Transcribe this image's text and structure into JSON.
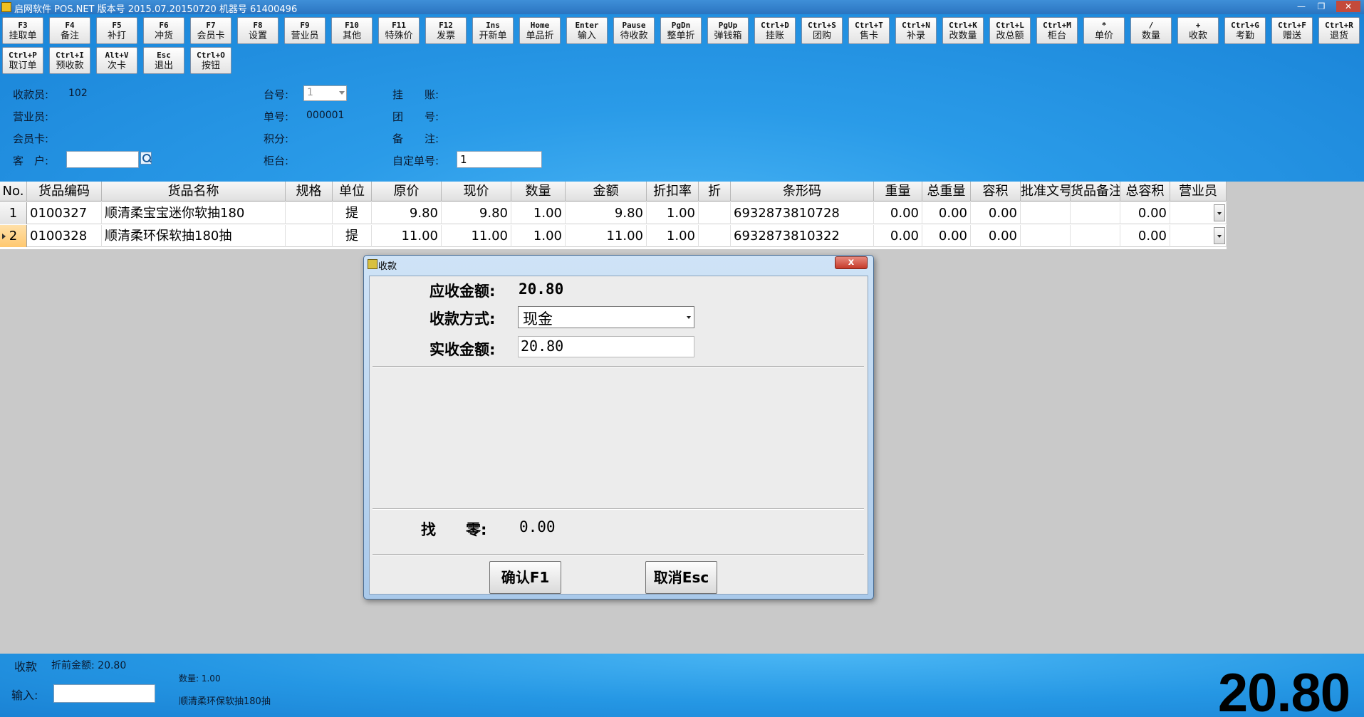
{
  "window": {
    "title": "启网软件 POS.NET 版本号 2015.07.20150720 机器号 61400496",
    "min_glyph": "—",
    "max_glyph": "❐",
    "close_glyph": "✕"
  },
  "toolbar": [
    {
      "key": "F3",
      "label": "挂取单"
    },
    {
      "key": "F4",
      "label": "备注"
    },
    {
      "key": "F5",
      "label": "补打"
    },
    {
      "key": "F6",
      "label": "冲货"
    },
    {
      "key": "F7",
      "label": "会员卡"
    },
    {
      "key": "F8",
      "label": "设置"
    },
    {
      "key": "F9",
      "label": "营业员"
    },
    {
      "key": "F10",
      "label": "其他"
    },
    {
      "key": "F11",
      "label": "特殊价"
    },
    {
      "key": "F12",
      "label": "发票"
    },
    {
      "key": "Ins",
      "label": "开新单"
    },
    {
      "key": "Home",
      "label": "单品折"
    },
    {
      "key": "Enter",
      "label": "输入"
    },
    {
      "key": "Pause",
      "label": "待收款"
    },
    {
      "key": "PgDn",
      "label": "整单折"
    },
    {
      "key": "PgUp",
      "label": "弹钱箱"
    },
    {
      "key": "Ctrl+D",
      "label": "挂账"
    },
    {
      "key": "Ctrl+S",
      "label": "团购"
    },
    {
      "key": "Ctrl+T",
      "label": "售卡"
    },
    {
      "key": "Ctrl+N",
      "label": "补录"
    },
    {
      "key": "Ctrl+K",
      "label": "改数量"
    },
    {
      "key": "Ctrl+L",
      "label": "改总额"
    },
    {
      "key": "Ctrl+M",
      "label": "柜台"
    },
    {
      "key": "*",
      "label": "单价"
    },
    {
      "key": "/",
      "label": "数量"
    },
    {
      "key": "+",
      "label": "收款"
    },
    {
      "key": "Ctrl+G",
      "label": "考勤"
    },
    {
      "key": "Ctrl+F",
      "label": "赠送"
    },
    {
      "key": "Ctrl+R",
      "label": "退货"
    },
    {
      "key": "Ctrl+P",
      "label": "取订单"
    },
    {
      "key": "Ctrl+I",
      "label": "预收款"
    },
    {
      "key": "Alt+V",
      "label": "次卡"
    },
    {
      "key": "Esc",
      "label": "退出"
    },
    {
      "key": "Ctrl+O",
      "label": "按钮"
    }
  ],
  "info": {
    "cashier_label": "收款员:",
    "cashier_value": "102",
    "salesperson_label": "营业员:",
    "member_label": "会员卡:",
    "customer_label": "客　户:",
    "customer_value": "",
    "table_label": "台号:",
    "table_value": "1",
    "order_no_label": "单号:",
    "order_no_value": "000001",
    "points_label": "积分:",
    "counter_label": "柜台:",
    "account_label": "挂　　账:",
    "group_label": "团　　号:",
    "remark_label": "备　　注:",
    "custom_no_label": "自定单号:",
    "custom_no_value": "1"
  },
  "grid": {
    "columns": [
      "No.",
      "货品编码",
      "货品名称",
      "规格",
      "单位",
      "原价",
      "现价",
      "数量",
      "金额",
      "折扣率",
      "折",
      "条形码",
      "重量",
      "总重量",
      "容积",
      "批准文号",
      "货品备注",
      "总容积",
      "营业员"
    ],
    "rows": [
      {
        "no": "1",
        "code": "0100327",
        "name": "顺清柔宝宝迷你软抽180",
        "spec": "",
        "unit": "提",
        "orig_price": "9.80",
        "price": "9.80",
        "qty": "1.00",
        "amount": "9.80",
        "discount": "1.00",
        "zhe": "",
        "barcode": "6932873810728",
        "weight": "0.00",
        "total_weight": "0.00",
        "volume": "0.00",
        "approval": "",
        "remark": "",
        "total_volume": "0.00",
        "clerk": ""
      },
      {
        "no": "2",
        "code": "0100328",
        "name": "顺清柔环保软抽180抽",
        "spec": "",
        "unit": "提",
        "orig_price": "11.00",
        "price": "11.00",
        "qty": "1.00",
        "amount": "11.00",
        "discount": "1.00",
        "zhe": "",
        "barcode": "6932873810322",
        "weight": "0.00",
        "total_weight": "0.00",
        "volume": "0.00",
        "approval": "",
        "remark": "",
        "total_volume": "0.00",
        "clerk": ""
      }
    ]
  },
  "dialog": {
    "title": "收款",
    "close_glyph": "x",
    "due_label": "应收金额:",
    "due_value": "20.80",
    "method_label": "收款方式:",
    "method_value": "现金",
    "received_label": "实收金额:",
    "received_value": "20.80",
    "change_label": "找　　零:",
    "change_value": "0.00",
    "confirm_label": "确认F1",
    "cancel_label": "取消Esc"
  },
  "footer": {
    "status": "收款",
    "pre_discount": "折前金额: 20.80",
    "input_label": "输入:",
    "input_value": "",
    "qty_text": "数量: 1.00",
    "current_item": "顺清柔环保软抽180抽",
    "total": "20.80"
  },
  "colors": {
    "top_blue": "#2a9be8",
    "dialog_bg": "#ececec",
    "row_selected": "#ffc870"
  }
}
